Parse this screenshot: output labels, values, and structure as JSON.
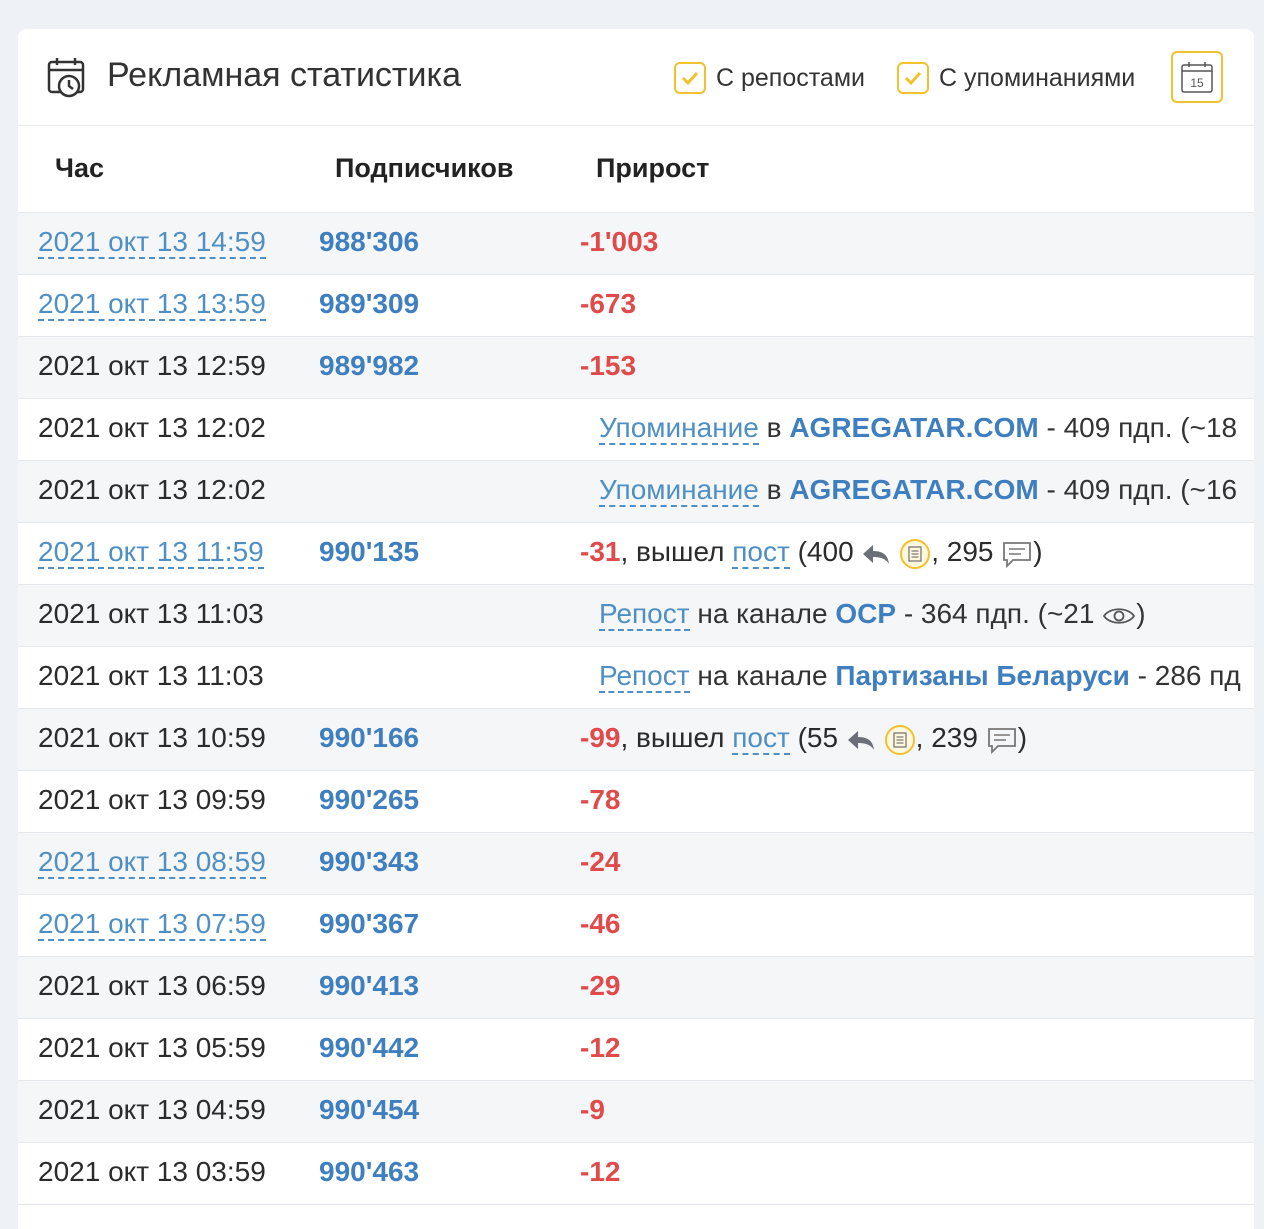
{
  "header": {
    "title": "Рекламная статистика",
    "filter_reposts": "С репостами",
    "filter_mentions": "С упоминаниями",
    "calendar_day": "15"
  },
  "columns": {
    "hour": "Час",
    "subscribers": "Подписчиков",
    "growth": "Прирост"
  },
  "rows": [
    {
      "time": "2021 окт 13 14:59",
      "subs": "988'306",
      "delta": "-1'003"
    },
    {
      "time": "2021 окт 13 13:59",
      "subs": "989'309",
      "delta": "-673"
    },
    {
      "time": "2021 окт 13 12:59",
      "subs": "989'982",
      "delta": "-153"
    },
    {
      "time": "2021 окт 13 12:02",
      "event": {
        "type": "Упоминание",
        "prep": "в",
        "channel": "AGREGATAR.COM",
        "rest": "- 409 пдп. (~18"
      }
    },
    {
      "time": "2021 окт 13 12:02",
      "event": {
        "type": "Упоминание",
        "prep": "в",
        "channel": "AGREGATAR.COM",
        "rest": "- 409 пдп. (~16"
      }
    },
    {
      "time": "2021 окт 13 11:59",
      "subs": "990'135",
      "delta": "-31",
      "post": {
        "text": ", вышел",
        "link": "пост",
        "reposts": "(400",
        "comments": ", 295",
        "close": ")"
      }
    },
    {
      "time": "2021 окт 13 11:03",
      "event": {
        "type": "Репост",
        "prep": "на канале",
        "channel": "ОСР",
        "rest": "- 364 пдп. (~21",
        "close": ")"
      }
    },
    {
      "time": "2021 окт 13 11:03",
      "event": {
        "type": "Репост",
        "prep": "на канале",
        "channel": "Партизаны Беларуси",
        "rest": "- 286 пд"
      }
    },
    {
      "time": "2021 окт 13 10:59",
      "subs": "990'166",
      "delta": "-99",
      "post": {
        "text": ", вышел",
        "link": "пост",
        "reposts": "(55",
        "comments": ", 239",
        "close": ")"
      }
    },
    {
      "time": "2021 окт 13 09:59",
      "subs": "990'265",
      "delta": "-78"
    },
    {
      "time": "2021 окт 13 08:59",
      "subs": "990'343",
      "delta": "-24"
    },
    {
      "time": "2021 окт 13 07:59",
      "subs": "990'367",
      "delta": "-46"
    },
    {
      "time": "2021 окт 13 06:59",
      "subs": "990'413",
      "delta": "-29"
    },
    {
      "time": "2021 окт 13 05:59",
      "subs": "990'442",
      "delta": "-12"
    },
    {
      "time": "2021 окт 13 04:59",
      "subs": "990'454",
      "delta": "-9"
    },
    {
      "time": "2021 окт 13 03:59",
      "subs": "990'463",
      "delta": "-12"
    }
  ],
  "colors": {
    "accent": "#f2c12e",
    "link": "#4f8fc4",
    "negative": "#e04a4a",
    "subs": "#3f7fbf"
  }
}
